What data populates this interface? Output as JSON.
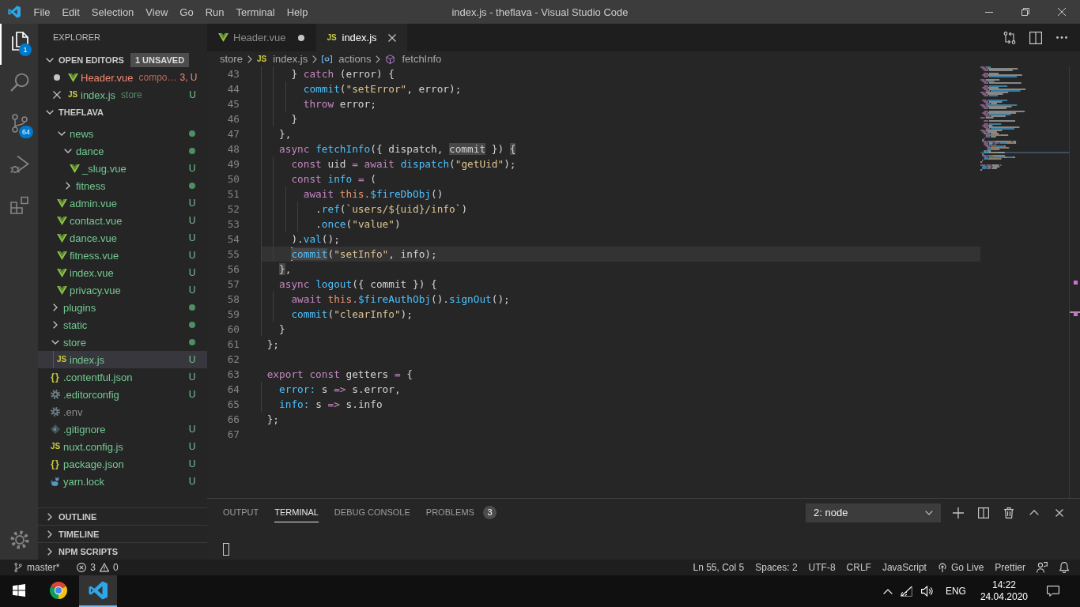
{
  "window": {
    "title": "index.js - theflava - Visual Studio Code"
  },
  "menu": [
    "File",
    "Edit",
    "Selection",
    "View",
    "Go",
    "Run",
    "Terminal",
    "Help"
  ],
  "activity_bar": {
    "items": [
      {
        "kind": "explorer",
        "selected": true,
        "badge": "1"
      },
      {
        "kind": "search",
        "selected": false
      },
      {
        "kind": "source_control",
        "selected": false,
        "badge": "64"
      },
      {
        "kind": "run",
        "selected": false
      },
      {
        "kind": "extensions",
        "selected": false
      }
    ]
  },
  "sidebar": {
    "title": "EXPLORER",
    "open_editors": {
      "title": "OPEN EDITORS",
      "expanded": true,
      "badge": "1 UNSAVED",
      "items": [
        {
          "label": "Header.vue",
          "kind": "vue",
          "dirty": true,
          "description": "compo…",
          "decoration": "3, U",
          "errors": true
        },
        {
          "label": "index.js",
          "kind": "js",
          "glyph": "JS",
          "dirty": false,
          "description": "store",
          "decoration": "U",
          "errors": false
        }
      ]
    },
    "folder": {
      "title": "THEFLAVA",
      "expanded": true,
      "tree": [
        {
          "children": [
            {
              "label": "news",
              "kind": "folder",
              "expanded": true,
              "selected": false,
              "ignored": false,
              "children": [
                {
                  "label": "dance",
                  "kind": "folder",
                  "expanded": true,
                  "selected": false,
                  "ignored": false,
                  "children": [
                    {
                      "label": "_slug.vue",
                      "kind": "vue",
                      "selected": false,
                      "ignored": false,
                      "decoration": "U"
                    }
                  ]
                },
                {
                  "label": "fitness",
                  "kind": "folder",
                  "expanded": false,
                  "selected": false,
                  "ignored": false
                }
              ]
            },
            {
              "label": "admin.vue",
              "kind": "vue",
              "selected": false,
              "ignored": false,
              "decoration": "U"
            },
            {
              "label": "contact.vue",
              "kind": "vue",
              "selected": false,
              "ignored": false,
              "decoration": "U"
            },
            {
              "label": "dance.vue",
              "kind": "vue",
              "selected": false,
              "ignored": false,
              "decoration": "U"
            },
            {
              "label": "fitness.vue",
              "kind": "vue",
              "selected": false,
              "ignored": false,
              "decoration": "U"
            },
            {
              "label": "index.vue",
              "kind": "vue",
              "selected": false,
              "ignored": false,
              "decoration": "U"
            },
            {
              "label": "privacy.vue",
              "kind": "vue",
              "selected": false,
              "ignored": false,
              "decoration": "U"
            }
          ]
        },
        {
          "label": "plugins",
          "kind": "folder",
          "expanded": false,
          "selected": false,
          "ignored": false
        },
        {
          "label": "static",
          "kind": "folder",
          "expanded": false,
          "selected": false,
          "ignored": false
        },
        {
          "label": "store",
          "kind": "folder",
          "expanded": true,
          "selected": false,
          "ignored": false,
          "children": [
            {
              "label": "index.js",
              "kind": "js",
              "glyph": "JS",
              "selected": true,
              "ignored": false,
              "decoration": "U"
            }
          ]
        },
        {
          "label": ".contentful.json",
          "kind": "json",
          "glyph": "{}",
          "selected": false,
          "ignored": false,
          "decoration": "U"
        },
        {
          "label": ".editorconfig",
          "kind": "config",
          "selected": false,
          "ignored": false,
          "decoration": "U"
        },
        {
          "label": ".env",
          "kind": "config",
          "selected": false,
          "ignored": true
        },
        {
          "label": ".gitignore",
          "kind": "git",
          "selected": false,
          "ignored": false,
          "decoration": "U"
        },
        {
          "label": "nuxt.config.js",
          "kind": "js",
          "glyph": "JS",
          "selected": false,
          "ignored": false,
          "decoration": "U"
        },
        {
          "label": "package.json",
          "kind": "json",
          "glyph": "{}",
          "selected": false,
          "ignored": false,
          "decoration": "U"
        },
        {
          "label": "yarn.lock",
          "kind": "yarn",
          "selected": false,
          "ignored": false,
          "decoration": "U"
        }
      ]
    },
    "sections": [
      {
        "title": "OUTLINE",
        "expanded": false
      },
      {
        "title": "TIMELINE",
        "expanded": false
      },
      {
        "title": "NPM SCRIPTS",
        "expanded": false
      }
    ]
  },
  "editor": {
    "tabs": [
      {
        "label": "Header.vue",
        "kind": "vue",
        "selected": false,
        "dirty": true
      },
      {
        "label": "index.js",
        "kind": "js",
        "glyph": "JS",
        "selected": true,
        "dirty": false
      }
    ],
    "breadcrumbs": [
      {
        "label": "store",
        "kind": "folder"
      },
      {
        "label": "index.js",
        "kind": "js",
        "glyph": "JS"
      },
      {
        "label": "actions",
        "kind": "variable"
      },
      {
        "label": "fetchInfo",
        "kind": "method"
      }
    ],
    "lines": [
      {
        "number": "43",
        "current": false,
        "tokens": [
          {
            "text": "    } ",
            "kind": "plain",
            "highlighted": false
          },
          {
            "text": "catch",
            "kind": "keyword",
            "highlighted": false
          },
          {
            "text": " (error) {",
            "kind": "plain",
            "highlighted": false
          }
        ]
      },
      {
        "number": "44",
        "current": false,
        "tokens": [
          {
            "text": "      commit",
            "kind": "function",
            "highlighted": false
          },
          {
            "text": "(",
            "kind": "plain",
            "highlighted": false
          },
          {
            "text": "\"setError\"",
            "kind": "string",
            "highlighted": false
          },
          {
            "text": ", error);",
            "kind": "plain",
            "highlighted": false
          }
        ]
      },
      {
        "number": "45",
        "current": false,
        "tokens": [
          {
            "text": "      throw",
            "kind": "keyword",
            "highlighted": false
          },
          {
            "text": " error;",
            "kind": "plain",
            "highlighted": false
          }
        ]
      },
      {
        "number": "46",
        "current": false,
        "tokens": [
          {
            "text": "    }",
            "kind": "plain",
            "highlighted": false
          }
        ]
      },
      {
        "number": "47",
        "current": false,
        "tokens": [
          {
            "text": "  },",
            "kind": "plain",
            "highlighted": false
          }
        ]
      },
      {
        "number": "48",
        "current": false,
        "tokens": [
          {
            "text": "  async",
            "kind": "keyword",
            "highlighted": false
          },
          {
            "text": " fetchInfo",
            "kind": "function",
            "highlighted": false
          },
          {
            "text": "({ dispatch, ",
            "kind": "plain",
            "highlighted": false
          },
          {
            "text": "commit",
            "kind": "plain",
            "highlighted": true
          },
          {
            "text": " }) ",
            "kind": "plain",
            "highlighted": false
          },
          {
            "text": "{",
            "kind": "plain",
            "highlighted": true
          }
        ]
      },
      {
        "number": "49",
        "current": false,
        "tokens": [
          {
            "text": "    const",
            "kind": "keyword",
            "highlighted": false
          },
          {
            "text": " uid ",
            "kind": "plain",
            "highlighted": false
          },
          {
            "text": "=",
            "kind": "keyword",
            "highlighted": false
          },
          {
            "text": " await",
            "kind": "keyword",
            "highlighted": false
          },
          {
            "text": " dispatch",
            "kind": "function",
            "highlighted": false
          },
          {
            "text": "(",
            "kind": "plain",
            "highlighted": false
          },
          {
            "text": "\"getUid\"",
            "kind": "string",
            "highlighted": false
          },
          {
            "text": ");",
            "kind": "plain",
            "highlighted": false
          }
        ]
      },
      {
        "number": "50",
        "current": false,
        "tokens": [
          {
            "text": "    const",
            "kind": "keyword",
            "highlighted": false
          },
          {
            "text": " info",
            "kind": "function",
            "highlighted": false
          },
          {
            "text": " =",
            "kind": "keyword",
            "highlighted": false
          },
          {
            "text": " (",
            "kind": "plain",
            "highlighted": false
          }
        ]
      },
      {
        "number": "51",
        "current": false,
        "tokens": [
          {
            "text": "      await",
            "kind": "keyword",
            "highlighted": false
          },
          {
            "text": " this.",
            "kind": "this",
            "highlighted": false
          },
          {
            "text": "$fireDbObj",
            "kind": "function",
            "highlighted": false
          },
          {
            "text": "()",
            "kind": "plain",
            "highlighted": false
          }
        ]
      },
      {
        "number": "52",
        "current": false,
        "tokens": [
          {
            "text": "        .",
            "kind": "plain",
            "highlighted": false
          },
          {
            "text": "ref",
            "kind": "function",
            "highlighted": false
          },
          {
            "text": "(",
            "kind": "plain",
            "highlighted": false
          },
          {
            "text": "`users/${uid}/info`",
            "kind": "string",
            "highlighted": false
          },
          {
            "text": ")",
            "kind": "plain",
            "highlighted": false
          }
        ]
      },
      {
        "number": "53",
        "current": false,
        "tokens": [
          {
            "text": "        .",
            "kind": "plain",
            "highlighted": false
          },
          {
            "text": "once",
            "kind": "function",
            "highlighted": false
          },
          {
            "text": "(",
            "kind": "plain",
            "highlighted": false
          },
          {
            "text": "\"value\"",
            "kind": "string",
            "highlighted": false
          },
          {
            "text": ")",
            "kind": "plain",
            "highlighted": false
          }
        ]
      },
      {
        "number": "54",
        "current": false,
        "tokens": [
          {
            "text": "    ).",
            "kind": "plain",
            "highlighted": false
          },
          {
            "text": "val",
            "kind": "function",
            "highlighted": false
          },
          {
            "text": "();",
            "kind": "plain",
            "highlighted": false
          }
        ]
      },
      {
        "number": "55",
        "current": true,
        "tokens": [
          {
            "text": "    commit",
            "kind": "function",
            "highlighted": true,
            "cursor": true
          },
          {
            "text": "(",
            "kind": "plain",
            "highlighted": false
          },
          {
            "text": "\"setInfo\"",
            "kind": "string",
            "highlighted": false
          },
          {
            "text": ", info);",
            "kind": "plain",
            "highlighted": false
          }
        ]
      },
      {
        "number": "56",
        "current": false,
        "tokens": [
          {
            "text": "  }",
            "kind": "plain",
            "highlighted": true
          },
          {
            "text": ",",
            "kind": "plain",
            "highlighted": false
          }
        ]
      },
      {
        "number": "57",
        "current": false,
        "tokens": [
          {
            "text": "  async",
            "kind": "keyword",
            "highlighted": false
          },
          {
            "text": " logout",
            "kind": "function",
            "highlighted": false
          },
          {
            "text": "({ commit }) {",
            "kind": "plain",
            "highlighted": false
          }
        ]
      },
      {
        "number": "58",
        "current": false,
        "tokens": [
          {
            "text": "    await",
            "kind": "keyword",
            "highlighted": false
          },
          {
            "text": " this.",
            "kind": "this",
            "highlighted": false
          },
          {
            "text": "$fireAuthObj",
            "kind": "function",
            "highlighted": false
          },
          {
            "text": "().",
            "kind": "plain",
            "highlighted": false
          },
          {
            "text": "signOut",
            "kind": "function",
            "highlighted": false
          },
          {
            "text": "();",
            "kind": "plain",
            "highlighted": false
          }
        ]
      },
      {
        "number": "59",
        "current": false,
        "tokens": [
          {
            "text": "    commit",
            "kind": "function",
            "highlighted": false
          },
          {
            "text": "(",
            "kind": "plain",
            "highlighted": false
          },
          {
            "text": "\"clearInfo\"",
            "kind": "string",
            "highlighted": false
          },
          {
            "text": ");",
            "kind": "plain",
            "highlighted": false
          }
        ]
      },
      {
        "number": "60",
        "current": false,
        "tokens": [
          {
            "text": "  }",
            "kind": "plain",
            "highlighted": false
          }
        ]
      },
      {
        "number": "61",
        "current": false,
        "tokens": [
          {
            "text": "};",
            "kind": "plain",
            "highlighted": false
          }
        ]
      },
      {
        "number": "62",
        "current": false
      },
      {
        "number": "63",
        "current": false,
        "tokens": [
          {
            "text": "export",
            "kind": "keyword",
            "highlighted": false
          },
          {
            "text": " const",
            "kind": "keyword",
            "highlighted": false
          },
          {
            "text": " getters ",
            "kind": "plain",
            "highlighted": false
          },
          {
            "text": "=",
            "kind": "keyword",
            "highlighted": false
          },
          {
            "text": " {",
            "kind": "plain",
            "highlighted": false
          }
        ]
      },
      {
        "number": "64",
        "current": false,
        "tokens": [
          {
            "text": "  error:",
            "kind": "function",
            "highlighted": false
          },
          {
            "text": " s ",
            "kind": "plain",
            "highlighted": false
          },
          {
            "text": "=>",
            "kind": "keyword",
            "highlighted": false
          },
          {
            "text": " s.error,",
            "kind": "plain",
            "highlighted": false
          }
        ]
      },
      {
        "number": "65",
        "current": false,
        "tokens": [
          {
            "text": "  info:",
            "kind": "function",
            "highlighted": false
          },
          {
            "text": " s ",
            "kind": "plain",
            "highlighted": false
          },
          {
            "text": "=>",
            "kind": "keyword",
            "highlighted": false
          },
          {
            "text": " s.info",
            "kind": "plain",
            "highlighted": false
          }
        ]
      },
      {
        "number": "66",
        "current": false,
        "tokens": [
          {
            "text": "};",
            "kind": "plain",
            "highlighted": false
          }
        ]
      },
      {
        "number": "67",
        "current": false
      }
    ]
  },
  "panel": {
    "tabs": [
      {
        "label": "OUTPUT",
        "selected": false
      },
      {
        "label": "TERMINAL",
        "selected": true
      },
      {
        "label": "DEBUG CONSOLE",
        "selected": false
      },
      {
        "label": "PROBLEMS",
        "selected": false,
        "badge": "3"
      }
    ],
    "terminal_select": {
      "value": "2: node"
    }
  },
  "status_bar": {
    "branch": "master*",
    "errors": "3",
    "warnings": "0",
    "items": [
      {
        "kind": "plain",
        "label": "Ln 55, Col 5"
      },
      {
        "kind": "plain",
        "label": "Spaces: 2"
      },
      {
        "kind": "plain",
        "label": "UTF-8"
      },
      {
        "kind": "plain",
        "label": "CRLF"
      },
      {
        "kind": "plain",
        "label": "JavaScript"
      },
      {
        "kind": "live",
        "label": "Go Live"
      },
      {
        "kind": "plain",
        "label": "Prettier"
      }
    ]
  },
  "taskbar": {
    "apps": [
      {
        "kind": "browser",
        "selected": false
      },
      {
        "kind": "editor",
        "selected": true
      }
    ],
    "language": "ENG",
    "time": "14:22",
    "date": "24.04.2020"
  }
}
